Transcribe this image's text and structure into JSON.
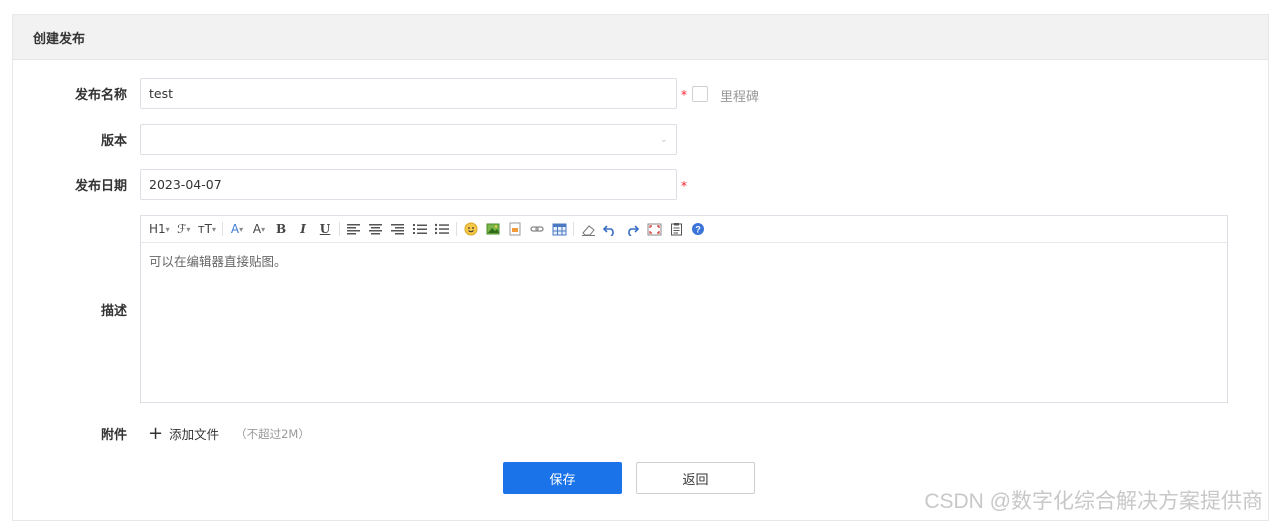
{
  "panel": {
    "title": "创建发布"
  },
  "form": {
    "release_name": {
      "label": "发布名称",
      "value": "test",
      "required_mark": "*"
    },
    "milestone": {
      "label": "里程碑"
    },
    "version": {
      "label": "版本",
      "value": ""
    },
    "release_date": {
      "label": "发布日期",
      "value": "2023-04-07",
      "required_mark": "*"
    },
    "description": {
      "label": "描述",
      "placeholder": "可以在编辑器直接贴图。"
    },
    "attachment": {
      "label": "附件",
      "add_label": "添加文件",
      "hint": "（不超过2M）"
    }
  },
  "toolbar": {
    "heading": "H1",
    "font_family": "ℱ",
    "font_size": "тT",
    "font_color": "A",
    "bg_color": "A",
    "bold": "B",
    "italic": "I",
    "underline": "U"
  },
  "buttons": {
    "save": "保存",
    "back": "返回"
  },
  "watermark": "CSDN @数字化综合解决方案提供商",
  "colors": {
    "primary": "#1a73e8",
    "required": "#f5222d",
    "highlight": "#f5d400"
  }
}
